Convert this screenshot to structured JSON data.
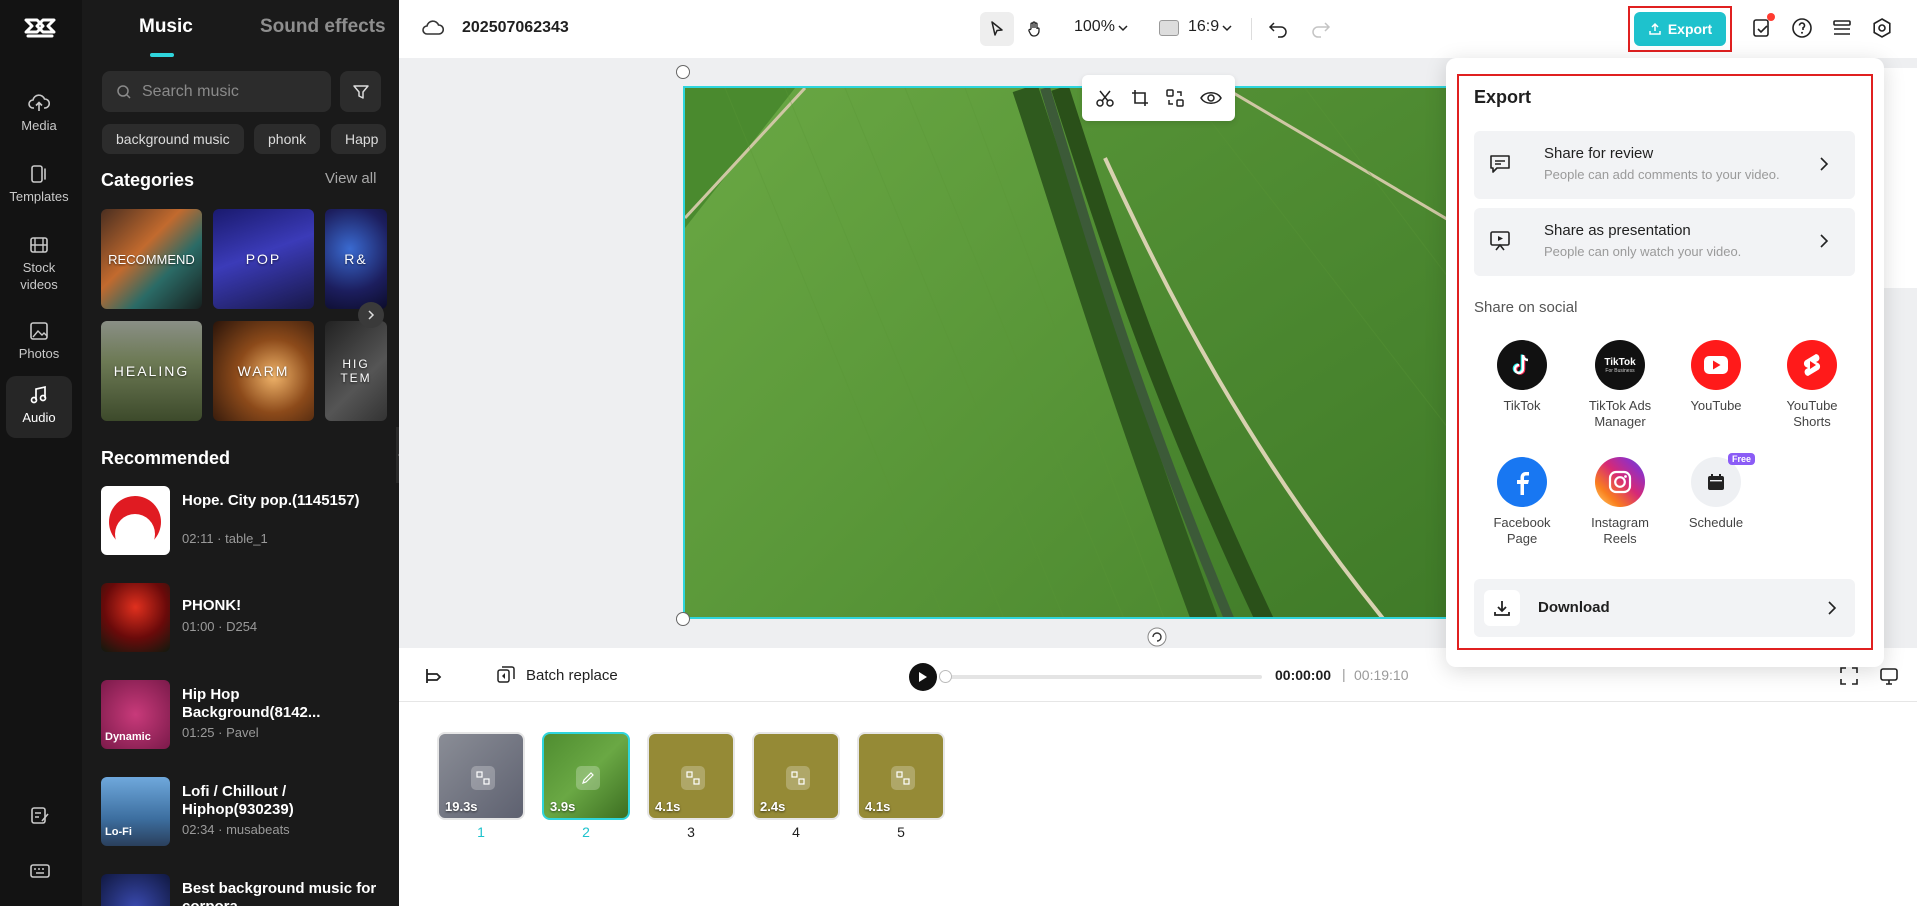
{
  "app": {
    "project_title": "202507062343",
    "zoom": "100%",
    "aspect_ratio": "16:9",
    "export_label": "Export"
  },
  "rail": {
    "items": [
      {
        "label": "Media",
        "icon": "cloud-upload-icon"
      },
      {
        "label": "Templates",
        "icon": "templates-icon"
      },
      {
        "label": "Stock videos",
        "icon": "film-icon"
      },
      {
        "label": "Photos",
        "icon": "image-icon"
      },
      {
        "label": "Audio",
        "icon": "music-note-icon",
        "active": true
      }
    ]
  },
  "panel": {
    "tabs": [
      "Music",
      "Sound effects"
    ],
    "search_placeholder": "Search music",
    "chips": [
      "background music",
      "phonk",
      "Happ"
    ],
    "categories_title": "Categories",
    "view_all": "View all",
    "categories": [
      "RECOMMEND",
      "POP",
      "R&",
      "HEALING",
      "WARM",
      "HIG TEM"
    ],
    "recommended_title": "Recommended",
    "songs": [
      {
        "title": "Hope. City pop.(1145157)",
        "meta": "02:11 · table_1"
      },
      {
        "title": "PHONK!",
        "meta": "01:00 · D254"
      },
      {
        "title": "Hip Hop Background(8142...",
        "meta": "01:25 · Pavel",
        "badge": "Dynamic"
      },
      {
        "title": "Lofi / Chillout / Hiphop(930239)",
        "meta": "02:34 · musabeats",
        "badge": "Lo-Fi"
      },
      {
        "title": "Best background music for corpora...",
        "meta": ""
      }
    ]
  },
  "playback": {
    "batch_replace": "Batch replace",
    "current_time": "00:00:00",
    "separator": "|",
    "total_time": "00:19:10"
  },
  "timeline": {
    "scenes": [
      {
        "num": "1",
        "duration": "19.3s"
      },
      {
        "num": "2",
        "duration": "3.9s",
        "active": true
      },
      {
        "num": "3",
        "duration": "4.1s"
      },
      {
        "num": "4",
        "duration": "2.4s"
      },
      {
        "num": "5",
        "duration": "4.1s"
      }
    ]
  },
  "export_panel": {
    "title": "Export",
    "share_review": {
      "title": "Share for review",
      "subtitle": "People can add comments to your video."
    },
    "share_presentation": {
      "title": "Share as presentation",
      "subtitle": "People can only watch your video."
    },
    "social_title": "Share on social",
    "socials": [
      {
        "label": "TikTok",
        "icon": "tiktok-icon"
      },
      {
        "label": "TikTok Ads Manager",
        "icon": "tiktok-business-icon"
      },
      {
        "label": "YouTube",
        "icon": "youtube-icon"
      },
      {
        "label": "YouTube Shorts",
        "icon": "youtube-shorts-icon"
      },
      {
        "label": "Facebook Page",
        "icon": "facebook-icon"
      },
      {
        "label": "Instagram Reels",
        "icon": "instagram-icon"
      },
      {
        "label": "Schedule",
        "icon": "calendar-icon",
        "badge": "Free"
      }
    ],
    "tiktok_business_text": "TikTok",
    "tiktok_business_sub": "For Business",
    "download": "Download"
  },
  "colors": {
    "accent": "#1ec2cd",
    "highlight": "#e02020",
    "rail_bg": "#131313",
    "panel_bg": "#1a1a1a"
  }
}
